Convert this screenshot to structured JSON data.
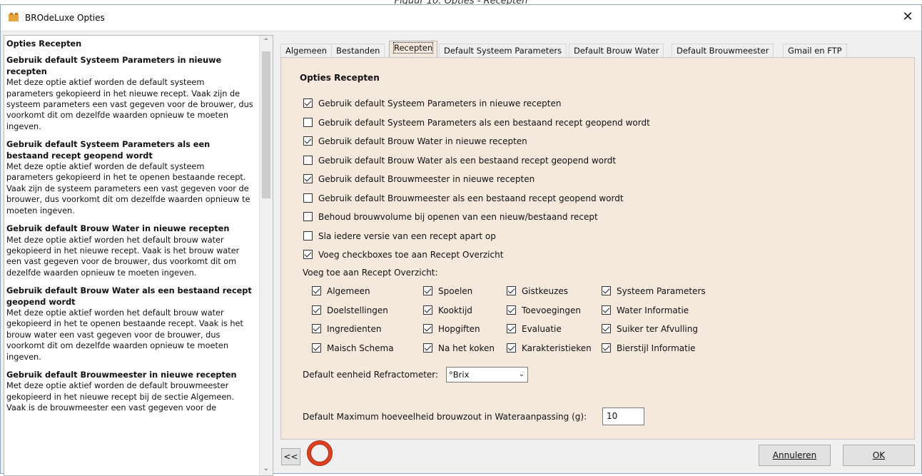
{
  "caption": "Figuur 10. Opties - Recepten",
  "window": {
    "title": "BROdeLuxe Opties",
    "close_glyph": "✕"
  },
  "help": {
    "heading": "Opties Recepten",
    "sections": [
      {
        "title": "Gebruik default Systeem Parameters in nieuwe recepten",
        "body": "Met deze optie aktief worden de default systeem parameters gekopieerd in het nieuwe recept. Vaak zijn de systeem parameters een vast gegeven voor de brouwer, dus voorkomt dit om dezelfde waarden opnieuw te moeten ingeven."
      },
      {
        "title": "Gebruik default Systeem Parameters als een bestaand recept geopend wordt",
        "body": "Met deze optie aktief worden de default systeem parameters gekopieerd in het te openen bestaande recept. Vaak zijn de systeem parameters een vast gegeven voor de brouwer, dus voorkomt dit om dezelfde waarden opnieuw  te moeten ingeven."
      },
      {
        "title": "Gebruik default Brouw Water in nieuwe recepten",
        "body": "Met deze optie aktief worden het default brouw water gekopieerd in het nieuwe recept. Vaak is het brouw water een vast gegeven voor de brouwer, dus voorkomt dit om dezelfde waarden opnieuw te moeten ingeven."
      },
      {
        "title": "Gebruik default Brouw Water als een bestaand recept geopend wordt",
        "body": "Met deze optie aktief worden het default brouw water gekopieerd in het te openen bestaande recept. Vaak is het brouw water een vast gegeven voor de brouwer, dus voorkomt dit om dezelfde waarden opnieuw te moeten ingeven."
      },
      {
        "title": "Gebruik default Brouwmeester in nieuwe recepten",
        "body": "Met deze optie aktief worden de default brouwmeester gekopieerd in het nieuwe recept bij de sectie Algemeen. Vaak is de brouwmeester een vast gegeven voor de"
      }
    ]
  },
  "tabs": [
    "Algemeen",
    "Bestanden",
    "Recepten",
    "Default Systeem Parameters",
    "Default Brouw Water",
    "Default Brouwmeester",
    "Gmail en FTP"
  ],
  "active_tab": "Recepten",
  "panel": {
    "title": "Opties Recepten",
    "options": [
      {
        "label": "Gebruik default Systeem Parameters in nieuwe recepten",
        "checked": true
      },
      {
        "label": "Gebruik default Systeem Parameters als een bestaand recept geopend wordt",
        "checked": false
      },
      {
        "label": "Gebruik default Brouw Water in nieuwe recepten",
        "checked": true
      },
      {
        "label": "Gebruik default Brouw Water als een bestaand recept geopend wordt",
        "checked": false
      },
      {
        "label": "Gebruik default Brouwmeester in nieuwe recepten",
        "checked": true
      },
      {
        "label": "Gebruik default Brouwmeester als een bestaand recept geopend wordt",
        "checked": false
      },
      {
        "label": "Behoud brouwvolume bij openen van een nieuw/bestaand recept",
        "checked": false
      },
      {
        "label": "Sla iedere versie van een recept apart op",
        "checked": false
      },
      {
        "label": "Voeg checkboxes toe aan Recept Overzicht",
        "checked": true
      }
    ],
    "overview_label": "Voeg toe aan Recept Overzicht:",
    "overview_grid": [
      [
        "Algemeen",
        "Spoelen",
        "Gistkeuzes",
        "Systeem Parameters"
      ],
      [
        "Doelstellingen",
        "Kooktijd",
        "Toevoegingen",
        "Water Informatie"
      ],
      [
        "Ingredienten",
        "Hopgiften",
        "Evaluatie",
        "Suiker ter Afvulling"
      ],
      [
        "Maisch Schema",
        "Na het koken",
        "Karakteristieken",
        "Bierstijl Informatie"
      ]
    ],
    "refractometer_label": "Default eenheid Refractometer:",
    "refractometer_value": "°Brix",
    "brewsalt_label": "Default Maximum hoeveelheid brouwzout in Wateraanpassing (g):",
    "brewsalt_value": "10"
  },
  "footer": {
    "back_label": "<<",
    "lifebuoy_icon": "lifebuoy-icon",
    "cancel_label": "Annuleren",
    "ok_label": "OK"
  },
  "colors": {
    "panel_bg": "#f5e8dc",
    "lifebuoy_red": "#e0401f"
  }
}
